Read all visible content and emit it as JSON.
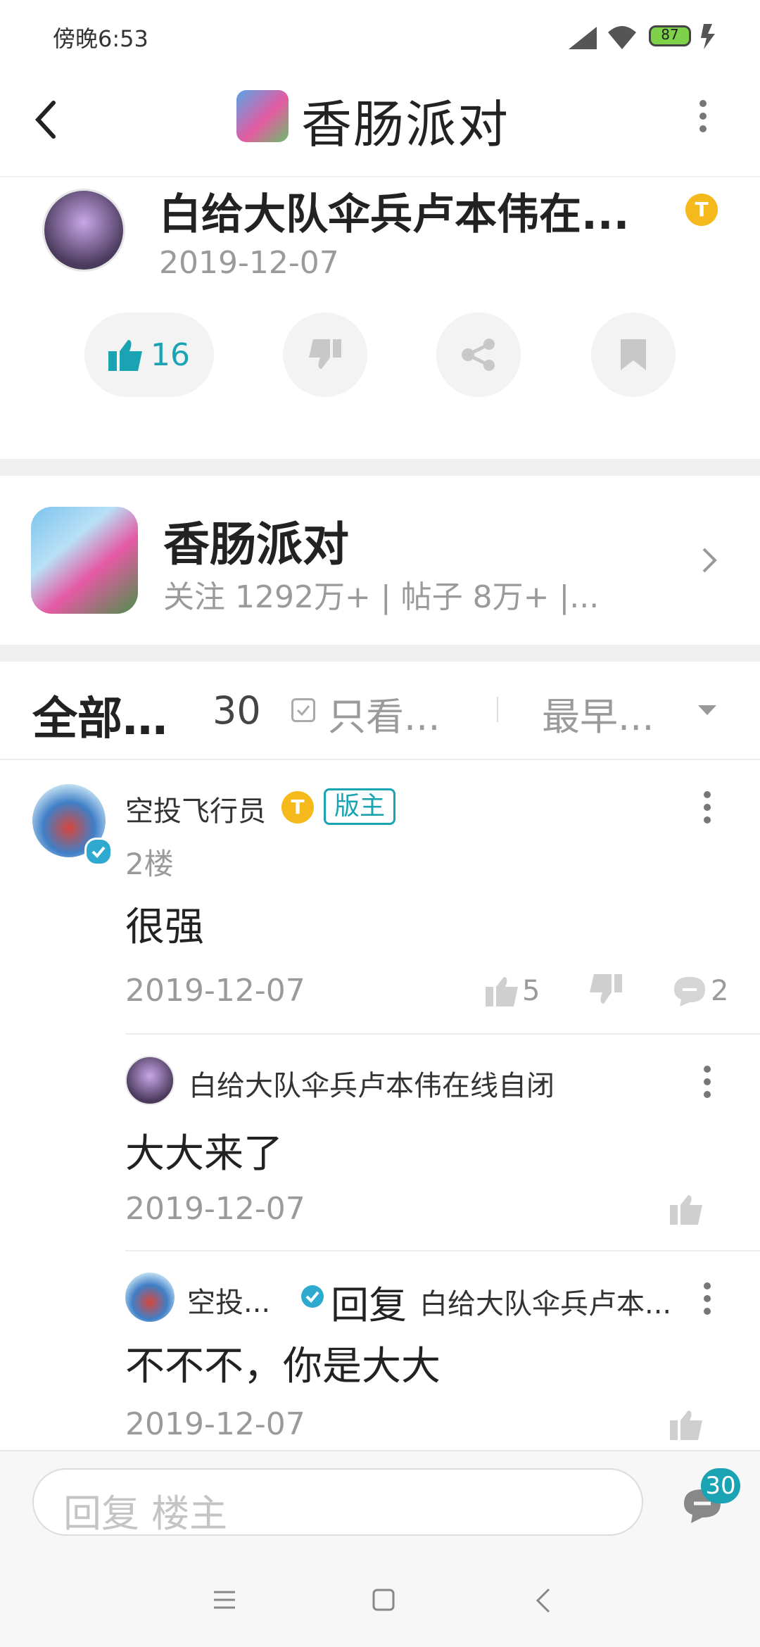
{
  "status_bar": {
    "time": "傍晚6:53",
    "battery": "87"
  },
  "app_bar": {
    "title": "香肠派对"
  },
  "post": {
    "author": "白给大队伞兵卢本伟在...",
    "date": "2019-12-07",
    "like_count": "16"
  },
  "forum": {
    "name": "香肠派对",
    "stats": "关注 1292万+ | 帖子 8万+ |..."
  },
  "filters": {
    "all_label": "全部...",
    "count": "30",
    "only_view_label": "只看...",
    "sort_label": "最早..."
  },
  "comment": {
    "author": "空投飞行员",
    "mod_label": "版主",
    "floor": "2楼",
    "text": "很强",
    "date": "2019-12-07",
    "likes": "5",
    "replies": "2"
  },
  "replies": [
    {
      "author": "白给大队伞兵卢本伟在线自闭",
      "text": "大大来了",
      "date": "2019-12-07"
    },
    {
      "author": "空投...",
      "reply_label": "回复",
      "reply_to": "白给大队伞兵卢本...",
      "text": "不不不，你是大大",
      "date": "2019-12-07"
    }
  ],
  "input_bar": {
    "placeholder": "回复  楼主",
    "comment_count": "30"
  },
  "colors": {
    "accent": "#1aa3b3",
    "divider": "#f0f0f0",
    "badge_gold": "#f6b91c"
  }
}
